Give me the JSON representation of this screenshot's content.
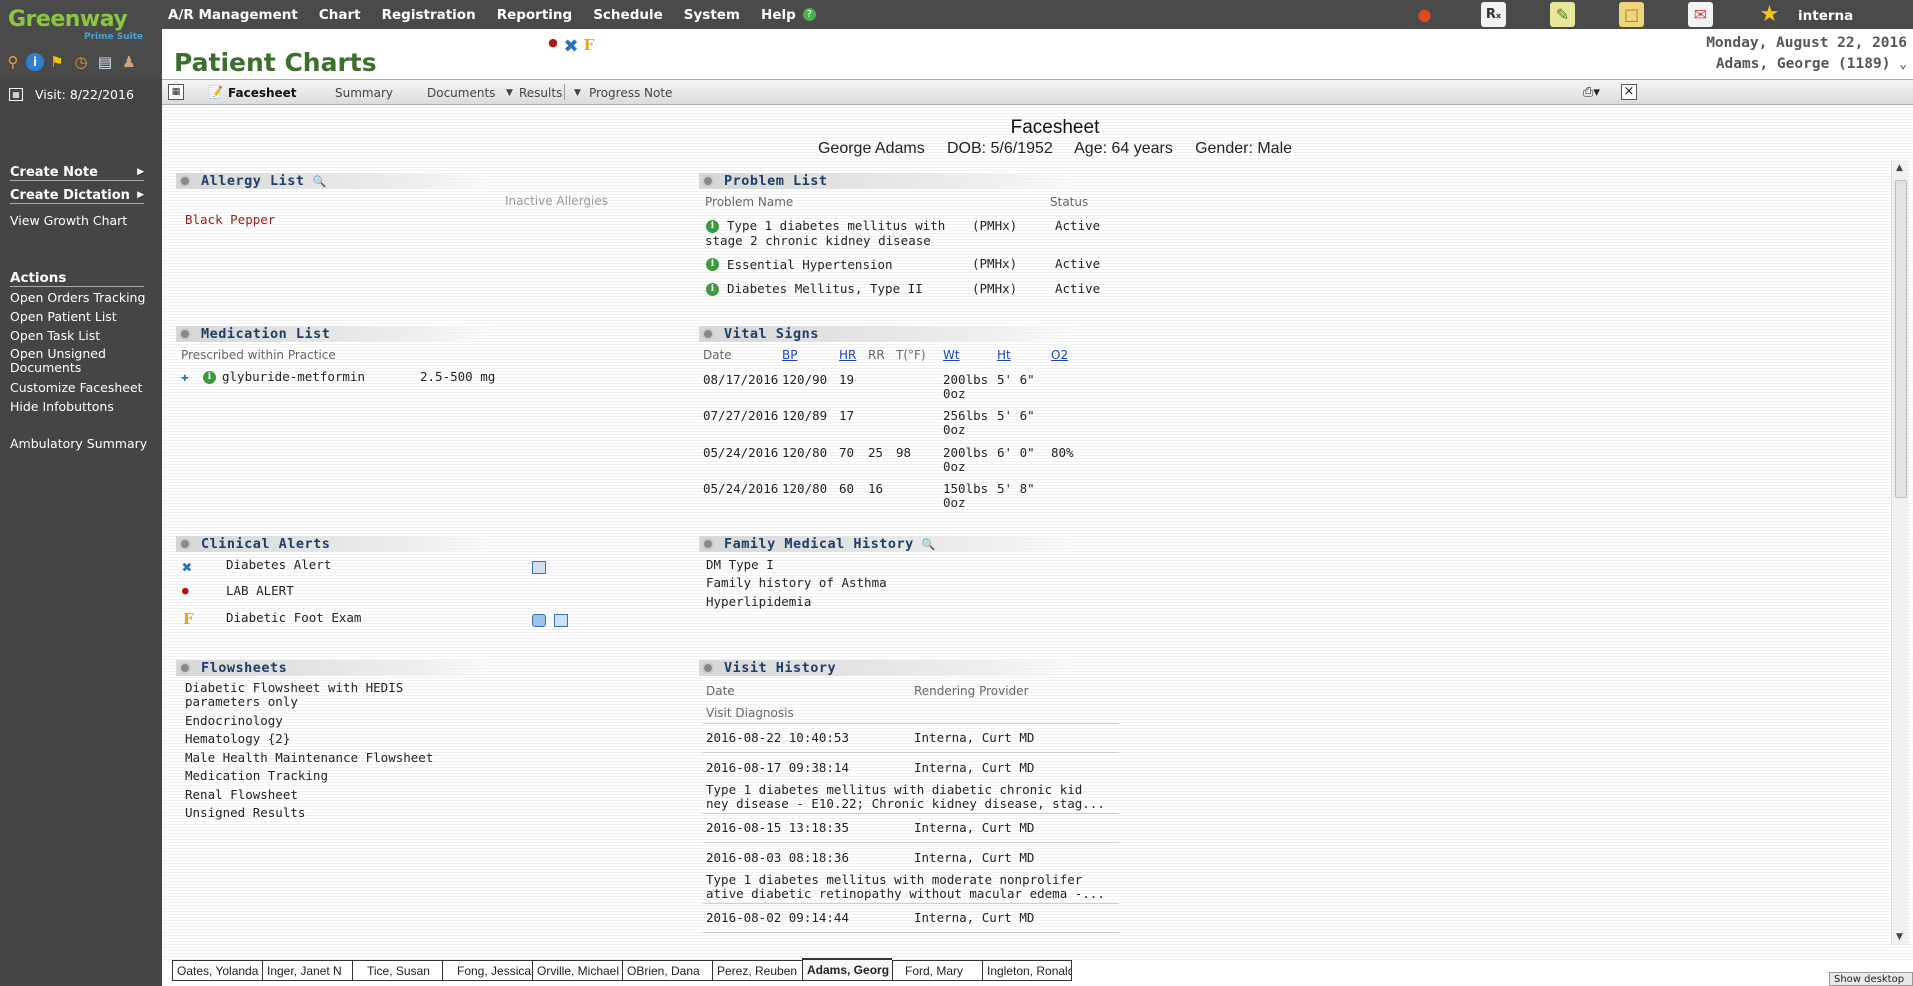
{
  "app": {
    "logo_main": "Greenway",
    "logo_sub": "Prime Suite",
    "page_title": "Patient Charts",
    "user": "interna"
  },
  "menu": [
    "A/R Management",
    "Chart",
    "Registration",
    "Reporting",
    "Schedule",
    "System",
    "Help"
  ],
  "header": {
    "date": "Monday, August 22, 2016",
    "patient": "Adams, George (1189)"
  },
  "sidebar": {
    "visit": "Visit: 8/22/2016",
    "create_note": "Create Note",
    "create_dictation": "Create Dictation",
    "view_growth_chart": "View Growth Chart",
    "actions_header": "Actions",
    "actions": [
      "Open Orders Tracking",
      "Open Patient List",
      "Open Task List",
      "Open Unsigned",
      "Documents",
      "Customize Facesheet",
      "Hide Infobuttons"
    ],
    "ambulatory": "Ambulatory Summary"
  },
  "tabs": {
    "facesheet": "Facesheet",
    "summary": "Summary",
    "documents": "Documents",
    "results": "Results",
    "progress_note": "Progress Note"
  },
  "facesheet": {
    "title": "Facesheet",
    "patient_line": "George Adams     DOB: 5/6/1952     Age: 64 years     Gender: Male"
  },
  "allergy": {
    "header": "Allergy List",
    "inactive": "Inactive Allergies",
    "items": [
      "Black Pepper"
    ]
  },
  "problem": {
    "header": "Problem List",
    "col_name": "Problem Name",
    "col_status": "Status",
    "items": [
      {
        "line1": "Type 1 diabetes mellitus with",
        "line2": "stage 2 chronic kidney disease",
        "type": "(PMHx)",
        "status": "Active"
      },
      {
        "line1": "Essential Hypertension",
        "line2": "",
        "type": "(PMHx)",
        "status": "Active"
      },
      {
        "line1": "Diabetes Mellitus, Type II",
        "line2": "",
        "type": "(PMHx)",
        "status": "Active"
      }
    ]
  },
  "medication": {
    "header": "Medication List",
    "subheader": "Prescribed within Practice",
    "items": [
      {
        "name": "glyburide-metformin",
        "dose": "2.5-500 mg"
      }
    ]
  },
  "vitals": {
    "header": "Vital Signs",
    "cols": [
      "Date",
      "BP",
      "HR",
      "RR",
      "T(°F)",
      "Wt",
      "Ht",
      "O2"
    ],
    "rows": [
      {
        "date": "08/17/2016",
        "bp": "120/90",
        "hr": "19",
        "rr": "",
        "t": "",
        "wt1": "200lbs",
        "wt2": "0oz",
        "ht": "5' 6\"",
        "o2": ""
      },
      {
        "date": "07/27/2016",
        "bp": "120/89",
        "hr": "17",
        "rr": "",
        "t": "",
        "wt1": "256lbs",
        "wt2": "0oz",
        "ht": "5' 6\"",
        "o2": ""
      },
      {
        "date": "05/24/2016",
        "bp": "120/80",
        "hr": "70",
        "rr": "25",
        "t": "98",
        "wt1": "200lbs",
        "wt2": "0oz",
        "ht": "6' 0\"",
        "o2": "80%"
      },
      {
        "date": "05/24/2016",
        "bp": "120/80",
        "hr": "60",
        "rr": "16",
        "t": "",
        "wt1": "150lbs",
        "wt2": "0oz",
        "ht": "5' 8\"",
        "o2": ""
      }
    ]
  },
  "alerts": {
    "header": "Clinical Alerts",
    "items": [
      "Diabetes Alert",
      "LAB ALERT",
      "Diabetic Foot Exam"
    ]
  },
  "family": {
    "header": "Family Medical History",
    "items": [
      "DM Type I",
      "Family history of Asthma",
      "Hyperlipidemia"
    ]
  },
  "flowsheets": {
    "header": "Flowsheets",
    "items": [
      "Diabetic Flowsheet with HEDIS",
      "parameters only",
      "Endocrinology",
      "Hematology {2}",
      "Male Health Maintenance Flowsheet",
      "Medication Tracking",
      "Renal Flowsheet",
      "Unsigned Results"
    ]
  },
  "visits": {
    "header": "Visit History",
    "col_date": "Date",
    "col_provider": "Rendering Provider",
    "col_diag": "Visit Diagnosis",
    "rows": [
      {
        "date": "2016-08-22 10:40:53",
        "provider": "Interna, Curt MD",
        "d1": "",
        "d2": ""
      },
      {
        "date": "2016-08-17 09:38:14",
        "provider": "Interna, Curt MD",
        "d1": "Type 1 diabetes mellitus with diabetic chronic kid",
        "d2": "ney disease - E10.22; Chronic kidney disease, stag..."
      },
      {
        "date": "2016-08-15 13:18:35",
        "provider": "Interna, Curt MD",
        "d1": "",
        "d2": ""
      },
      {
        "date": "2016-08-03 08:18:36",
        "provider": "Interna, Curt MD",
        "d1": "Type 1 diabetes mellitus with moderate nonprolifer",
        "d2": "ative diabetic retinopathy without macular edema -..."
      },
      {
        "date": "2016-08-02 09:14:44",
        "provider": "Interna, Curt MD",
        "d1": "",
        "d2": ""
      }
    ]
  },
  "patient_tabs": [
    "Oates, Yolanda",
    "Inger, Janet N",
    "Tice, Susan",
    "Fong, Jessica",
    "Orville, Michael",
    "OBrien, Dana",
    "Perez, Reuben",
    "Adams, Georg",
    "Ford, Mary",
    "Ingleton, Ronald"
  ],
  "active_patient_tab": "Adams, Georg",
  "show_desktop": "Show desktop",
  "icons": {
    "blood_label": "BLOOD",
    "f_label": "F"
  },
  "colors": {
    "header_green": "#3c6e2e",
    "section_blue": "#1e3e68",
    "allergy_red": "#9b1c1c",
    "sidebar": "#454545"
  }
}
